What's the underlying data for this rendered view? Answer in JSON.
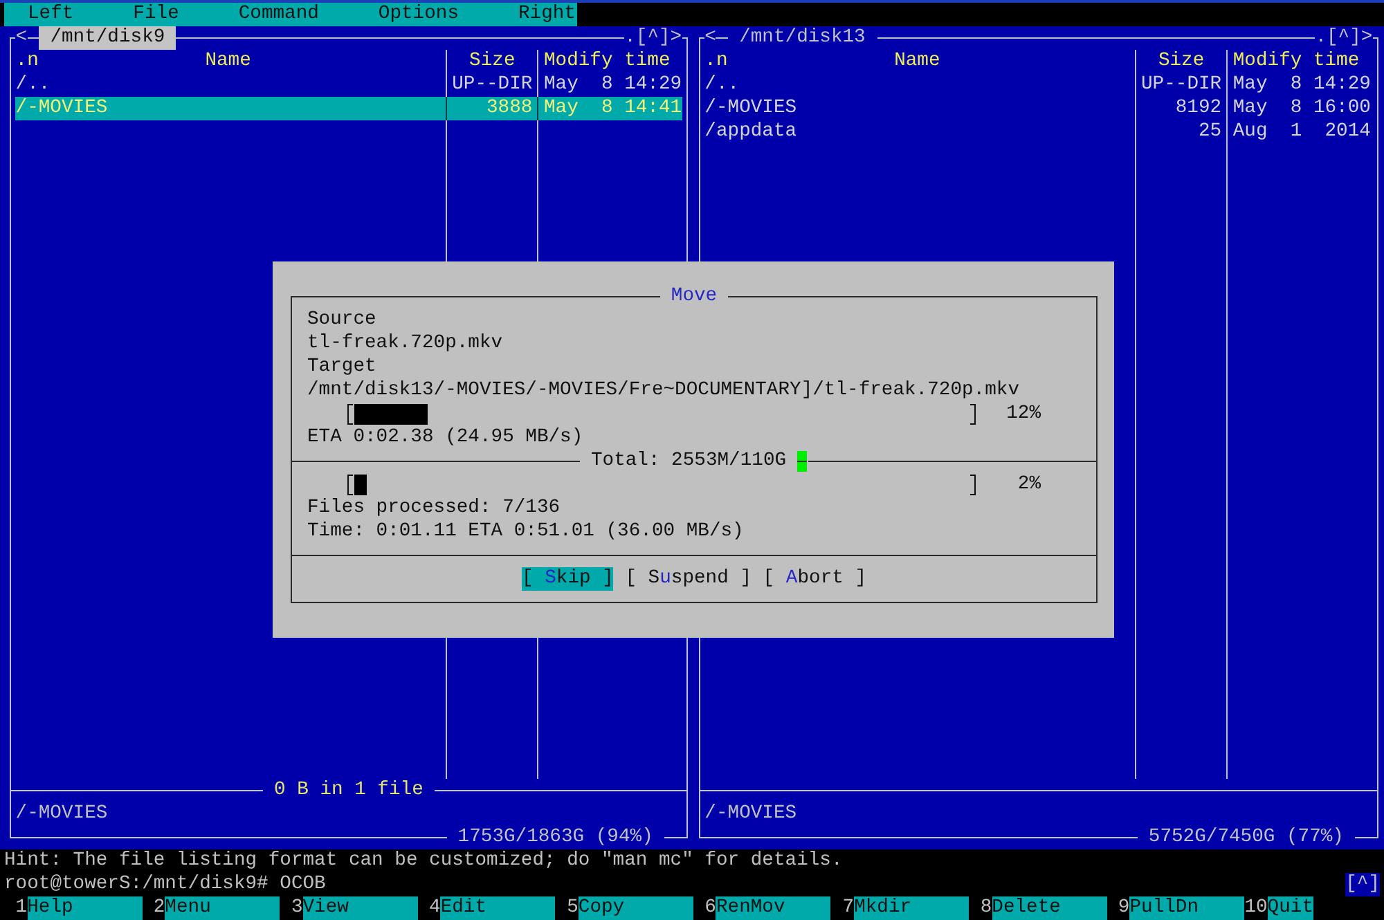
{
  "menu_bar": {
    "items": [
      "Left",
      "File",
      "Command",
      "Options",
      "Right"
    ]
  },
  "panels": [
    {
      "controls_left": [
        "<"
      ],
      "path": "/mnt/disk9",
      "selected": true,
      "controls_right": [
        ".",
        "[^]",
        ">"
      ],
      "sort_indicator": ".n",
      "columns": [
        "Name",
        "Size",
        "Modify time"
      ],
      "rows": [
        {
          "name": "/..",
          "size": "UP--DIR",
          "modified": "May  8 14:29",
          "selected": false
        },
        {
          "name": "/-MOVIES",
          "size": "3888",
          "modified": "May  8 14:41",
          "selected": true
        }
      ],
      "summary": "0 B in 1 file",
      "mini_status": "/-MOVIES",
      "disk_usage": "1753G/1863G (94%)"
    },
    {
      "controls_left": [
        "<"
      ],
      "path": "/mnt/disk13",
      "selected": false,
      "controls_right": [
        ".",
        "[^]",
        ">"
      ],
      "sort_indicator": ".n",
      "columns": [
        "Name",
        "Size",
        "Modify time"
      ],
      "rows": [
        {
          "name": "/..",
          "size": "UP--DIR",
          "modified": "May  8 14:29",
          "selected": false
        },
        {
          "name": "/-MOVIES",
          "size": "8192",
          "modified": "May  8 16:00",
          "selected": false
        },
        {
          "name": "/appdata",
          "size": "25",
          "modified": "Aug  1  2014",
          "selected": false
        }
      ],
      "mini_status": "/-MOVIES",
      "disk_usage": "5752G/7450G (77%)"
    }
  ],
  "dialog": {
    "title": "Move",
    "source_label": "Source",
    "source": "tl-freak.720p.mkv",
    "target_label": "Target",
    "target": "/mnt/disk13/-MOVIES/-MOVIES/Fre~DOCUMENTARY]/tl-freak.720p.mkv",
    "file_progress": {
      "level": 0.12,
      "percent": "12%"
    },
    "file_eta": "ETA 0:02.38 (24.95 MB/s)",
    "total": "Total: 2553M/110G",
    "total_progress": {
      "level": 0.02,
      "percent": "2%"
    },
    "files_processed": "Files processed: 7/136",
    "time": "Time: 0:01.11 ETA 0:51.01 (36.00 MB/s)",
    "buttons": [
      {
        "before": "[ ",
        "hotkey": "S",
        "after": "kip ]",
        "selected": true
      },
      {
        "before": "[ S",
        "hotkey": "u",
        "after": "spend ]",
        "selected": false
      },
      {
        "before": "[ ",
        "hotkey": "A",
        "after": "bort ]",
        "selected": false
      }
    ]
  },
  "hint": "Hint: The file listing format can be customized; do \"man mc\" for details.",
  "command_line": {
    "prompt": "root@towerS:/mnt/disk9#",
    "input": "OCOB",
    "history_button": "[^]"
  },
  "function_keys": [
    {
      "number": "1",
      "label": "Help"
    },
    {
      "number": "2",
      "label": "Menu"
    },
    {
      "number": "3",
      "label": "View"
    },
    {
      "number": "4",
      "label": "Edit"
    },
    {
      "number": "5",
      "label": "Copy"
    },
    {
      "number": "6",
      "label": "RenMov"
    },
    {
      "number": "7",
      "label": "Mkdir"
    },
    {
      "number": "8",
      "label": "Delete"
    },
    {
      "number": "9",
      "label": "PullDn"
    },
    {
      "number": "10",
      "label": "Quit"
    }
  ]
}
